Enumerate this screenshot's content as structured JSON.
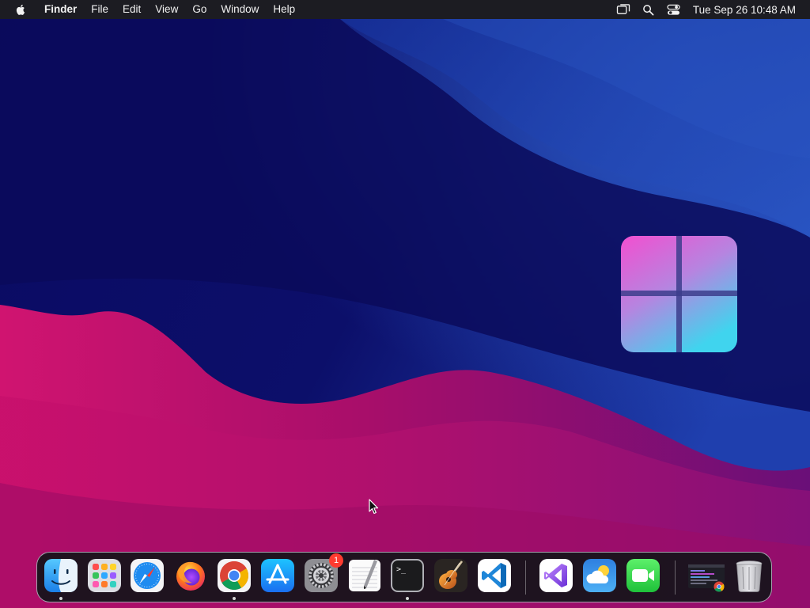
{
  "menubar": {
    "app_name": "Finder",
    "menus": [
      "File",
      "Edit",
      "View",
      "Go",
      "Window",
      "Help"
    ],
    "status_icons": [
      "screen-mirroring-icon",
      "spotlight-search-icon",
      "control-center-icon"
    ],
    "clock": "Tue Sep 26  10:48 AM"
  },
  "desktop": {
    "logo": "windows-logo"
  },
  "dock": {
    "apps": [
      {
        "name": "Finder",
        "icon": "finder-icon",
        "running": true
      },
      {
        "name": "Launchpad",
        "icon": "launchpad-icon",
        "running": false
      },
      {
        "name": "Safari",
        "icon": "safari-icon",
        "running": false
      },
      {
        "name": "Firefox",
        "icon": "firefox-icon",
        "running": false
      },
      {
        "name": "Google Chrome",
        "icon": "chrome-icon",
        "running": true
      },
      {
        "name": "App Store",
        "icon": "app-store-icon",
        "running": false
      },
      {
        "name": "System Settings",
        "icon": "system-settings-icon",
        "running": false,
        "badge": "1"
      },
      {
        "name": "TextEdit",
        "icon": "textedit-icon",
        "running": false
      },
      {
        "name": "Terminal",
        "icon": "terminal-icon",
        "running": true
      },
      {
        "name": "GarageBand",
        "icon": "garageband-icon",
        "running": false
      },
      {
        "name": "Visual Studio Code",
        "icon": "vscode-icon",
        "running": false
      },
      {
        "name": "Visual Studio",
        "icon": "visual-studio-icon",
        "running": false
      },
      {
        "name": "Weather",
        "icon": "weather-icon",
        "running": false
      },
      {
        "name": "FaceTime",
        "icon": "facetime-icon",
        "running": false
      },
      {
        "name": "Chrome Window",
        "icon": "chrome-window-thumbnail-icon",
        "running": false
      },
      {
        "name": "Trash",
        "icon": "trash-icon",
        "running": false
      }
    ]
  },
  "colors": {
    "menubar_bg": "#1c1c22",
    "wallpaper_navy": "#0b0b5c",
    "wallpaper_magenta": "#c4106a",
    "wallpaper_blue": "#1d3ea8",
    "badge": "#ff3b30"
  }
}
